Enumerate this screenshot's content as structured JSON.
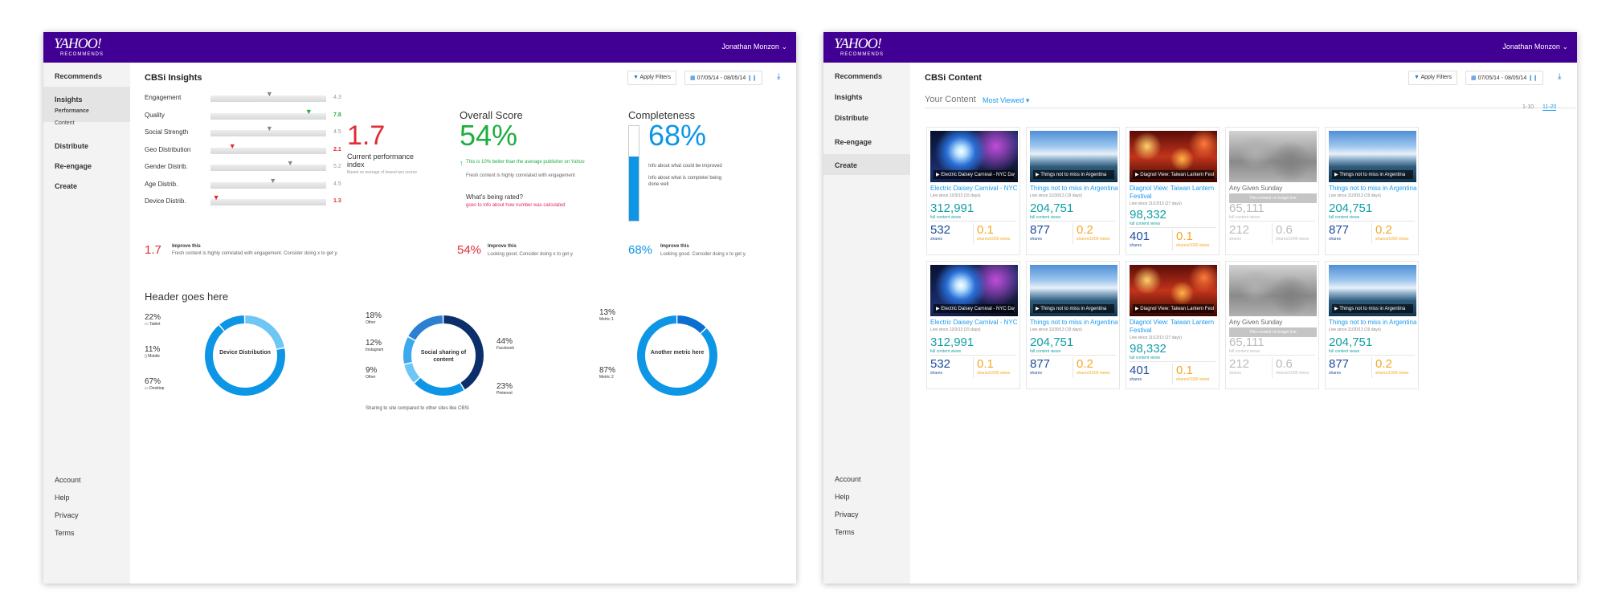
{
  "colors": {
    "purple": "#410093",
    "green": "#1fae3e",
    "red": "#e02b36",
    "blue": "#0d96e6",
    "teal": "#14a0a6",
    "navy": "#1d4b9c",
    "orange": "#f5a623"
  },
  "insights": {
    "logo": {
      "big": "YAHOO!",
      "small": "RECOMMENDS"
    },
    "user": "Jonathan Monzon",
    "nav": {
      "recommends": "Recommends",
      "insights": "Insights",
      "performance": "Performance",
      "content": "Content",
      "distribute": "Distribute",
      "reengage": "Re-engage",
      "create": "Create"
    },
    "footer": [
      "Account",
      "Help",
      "Privacy",
      "Terms"
    ],
    "title": "CBSi Insights",
    "apply_filters": "Apply Filters",
    "date_range": "07/05/14 - 08/05/14",
    "metrics": [
      {
        "label": "Engagement",
        "value": "4.3",
        "pos": 0.52,
        "arrow": "gray"
      },
      {
        "label": "Quality",
        "value": "7.8",
        "pos": 0.86,
        "arrow": "green"
      },
      {
        "label": "Social Strength",
        "value": "4.5",
        "pos": 0.52,
        "arrow": "gray"
      },
      {
        "label": "Geo Distribution",
        "value": "2.1",
        "pos": 0.2,
        "arrow": "red"
      },
      {
        "label": "Gender Distrib.",
        "value": "5.2",
        "pos": 0.7,
        "arrow": "gray"
      },
      {
        "label": "Age Distrib.",
        "value": "4.5",
        "pos": 0.55,
        "arrow": "gray"
      },
      {
        "label": "Device Distrib.",
        "value": "1.3",
        "pos": 0.06,
        "arrow": "red"
      }
    ],
    "cpi": {
      "value": "1.7",
      "label": "Current performance index",
      "note": "Based on average of lowest two scores"
    },
    "overall": {
      "title": "Overall Score",
      "value": "54%",
      "note1": "This is 10% better than the average publisher on Yahoo",
      "note2": "Fresh content is highly correlated with engagement",
      "rated_title": "What's being rated?",
      "rated_link": "goes to info about how number was calculated"
    },
    "completeness": {
      "title": "Completeness",
      "value": "68%",
      "fill": 0.68,
      "note1": "Info about what could be improved",
      "note2": "Info about what is complete/ being done well"
    },
    "improve": [
      {
        "value": "1.7",
        "title": "Improve this",
        "text": "Fresh content is highly correlated with engagement. Consider doing x to get y."
      },
      {
        "value": "54%",
        "title": "Improve this",
        "text": "Looking good. Consider doing x to get y."
      },
      {
        "value": "68%",
        "title": "Improve this",
        "text": "Looking good. Consider doing x to get y."
      }
    ],
    "header": "Header goes here",
    "donut1": {
      "center": "Device Distribution",
      "items": [
        {
          "pct": "22%",
          "label": "Tablet",
          "value": 22
        },
        {
          "pct": "11%",
          "label": "Mobile",
          "value": 11
        },
        {
          "pct": "67%",
          "label": "Desktop",
          "value": 67
        }
      ]
    },
    "donut2": {
      "center": "Social sharing of content",
      "items": [
        {
          "pct": "18%",
          "label": "Other",
          "value": 18
        },
        {
          "pct": "12%",
          "label": "Instagram",
          "value": 12
        },
        {
          "pct": "9%",
          "label": "Other",
          "value": 9
        },
        {
          "pct": "44%",
          "label": "Facebook",
          "value": 44
        },
        {
          "pct": "23%",
          "label": "Pinterest",
          "value": 23
        }
      ],
      "note": "Sharing to site compared to other sites like CBSi"
    },
    "donut3": {
      "center": "Another metric here",
      "items": [
        {
          "pct": "13%",
          "label": "Metric 1",
          "value": 13
        },
        {
          "pct": "87%",
          "label": "Metric 2",
          "value": 87
        }
      ]
    }
  },
  "content": {
    "logo": {
      "big": "YAHOO!",
      "small": "RECOMMENDS"
    },
    "user": "Jonathan Monzon",
    "nav": {
      "recommends": "Recommends",
      "insights": "Insights",
      "distribute": "Distribute",
      "reengage": "Re-engage",
      "create": "Create"
    },
    "footer": [
      "Account",
      "Help",
      "Privacy",
      "Terms"
    ],
    "title": "CBSi Content",
    "apply_filters": "Apply Filters",
    "date_range": "07/05/14 - 08/05/14",
    "your_content": "Your Content",
    "sort": "Most Viewed",
    "pages": [
      "1-10",
      "11-20"
    ],
    "full_views_label": "full content views",
    "shares_label": "shares",
    "rate_label": "shares/1000 views",
    "gone_label": "This content no longer live",
    "cards": [
      {
        "caption": "Electric Daisey Carnival - NYC Day 1",
        "title": "Electric Daisey Carnival - NYC",
        "since": "Live since 12/3/13 (15 days)",
        "views": "312,991",
        "shares": "532",
        "rate": "0.1",
        "theme": "carnival",
        "live": true
      },
      {
        "caption": "Things not to miss in Argentina",
        "title": "Things not to miss in Argentina",
        "since": "Live since 11/30/13 (19 days)",
        "views": "204,751",
        "shares": "877",
        "rate": "0.2",
        "theme": "glacier",
        "live": true
      },
      {
        "caption": "Diagnol View: Taiwan Lantern Festival",
        "title": "Diagnol View: Taiwan Lantern Festival",
        "since": "Live since 11/12/13 (27 days)",
        "views": "98,332",
        "shares": "401",
        "rate": "0.1",
        "theme": "lantern",
        "live": true
      },
      {
        "caption": "",
        "title": "Any Given Sunday",
        "since": "",
        "views": "65,111",
        "shares": "212",
        "rate": "0.6",
        "theme": "crowd",
        "live": false
      },
      {
        "caption": "Things not to miss in Argentina",
        "title": "Things not to miss in Argentina",
        "since": "Live since 11/30/13 (19 days)",
        "views": "204,751",
        "shares": "877",
        "rate": "0.2",
        "theme": "glacier",
        "live": true
      }
    ]
  }
}
